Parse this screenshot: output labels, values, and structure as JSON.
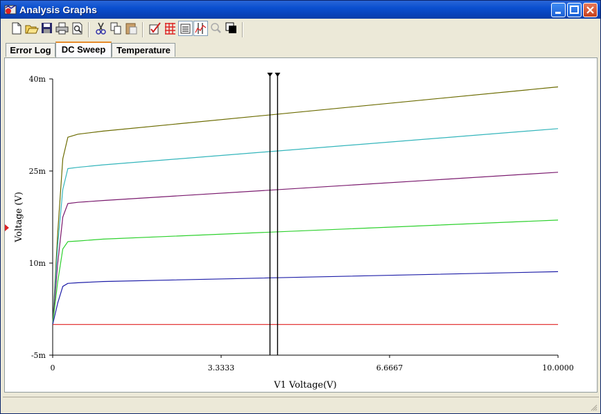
{
  "window": {
    "title": "Analysis Graphs"
  },
  "toolbar": {
    "buttons": [
      {
        "name": "new-icon"
      },
      {
        "name": "open-icon"
      },
      {
        "name": "save-icon"
      },
      {
        "name": "print-icon"
      },
      {
        "name": "print-preview-icon"
      },
      {
        "name": "cut-icon"
      },
      {
        "name": "copy-icon"
      },
      {
        "name": "paste-icon"
      },
      {
        "name": "properties-icon"
      },
      {
        "name": "grid-icon"
      },
      {
        "name": "legend-icon"
      },
      {
        "name": "cursors-icon"
      },
      {
        "name": "zoom-icon"
      },
      {
        "name": "reverse-colors-icon"
      }
    ]
  },
  "tabs": [
    {
      "label": "Error Log"
    },
    {
      "label": "DC Sweep"
    },
    {
      "label": "Temperature"
    }
  ],
  "chart_data": {
    "type": "line",
    "xlabel": "V1 Voltage(V)",
    "ylabel": "Voltage (V)",
    "xlim": [
      0,
      10
    ],
    "ylim": [
      -0.005,
      0.04
    ],
    "xticks": [
      "0",
      "3.3333",
      "6.6667",
      "10.0000"
    ],
    "yticks": [
      "40m",
      "25m",
      "10m",
      "-5m"
    ],
    "ytick_values": [
      0.04,
      0.025,
      0.01,
      -0.005
    ],
    "cursors": [
      4.3,
      4.45
    ],
    "series": [
      {
        "color": "#6b6b00",
        "x": [
          0,
          0.1,
          0.2,
          0.3,
          0.5,
          1,
          10
        ],
        "y": [
          0,
          0.015,
          0.027,
          0.0305,
          0.031,
          0.0315,
          0.0387
        ]
      },
      {
        "color": "#33b5bb",
        "x": [
          0,
          0.1,
          0.2,
          0.3,
          0.5,
          1,
          10
        ],
        "y": [
          0,
          0.013,
          0.022,
          0.0254,
          0.0256,
          0.026,
          0.0319
        ]
      },
      {
        "color": "#7a1a6e",
        "x": [
          0,
          0.1,
          0.2,
          0.3,
          0.5,
          1,
          10
        ],
        "y": [
          0,
          0.01,
          0.0175,
          0.0197,
          0.0199,
          0.0202,
          0.0248
        ]
      },
      {
        "color": "#2ed12e",
        "x": [
          0,
          0.1,
          0.2,
          0.3,
          0.5,
          1,
          10
        ],
        "y": [
          0,
          0.007,
          0.0123,
          0.0135,
          0.0136,
          0.0139,
          0.017
        ]
      },
      {
        "color": "#1e1ea8",
        "x": [
          0,
          0.1,
          0.2,
          0.3,
          0.5,
          1,
          10
        ],
        "y": [
          0,
          0.0035,
          0.0062,
          0.0067,
          0.0068,
          0.007,
          0.0086
        ]
      },
      {
        "color": "#e02020",
        "x": [
          0,
          10
        ],
        "y": [
          0,
          0
        ]
      }
    ]
  }
}
